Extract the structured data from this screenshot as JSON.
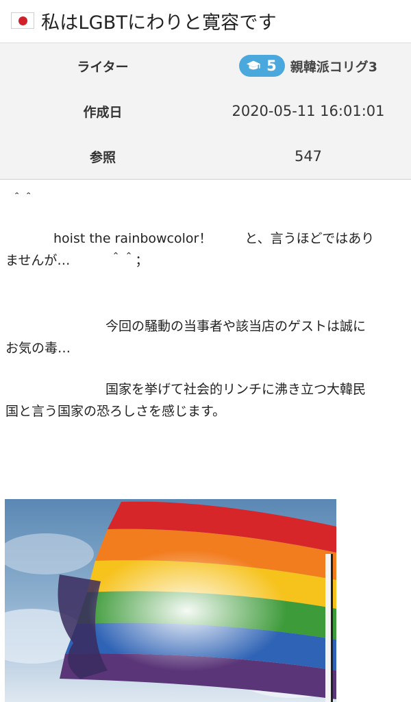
{
  "post": {
    "title": "私はLGBTにわりと寛容です",
    "flag_icon": "japan-flag-icon"
  },
  "meta": {
    "writer_label": "ライター",
    "writer_level": "5",
    "writer_name": "親韓派コリグ3",
    "date_label": "作成日",
    "date_value": "2020-05-11 16:01:01",
    "views_label": "参照",
    "views_value": "547"
  },
  "body": {
    "line_smile": "＾＾",
    "line1_a": "hoist the rainbowcolor！",
    "line1_b": "と、言うほどではあり",
    "line2": "ませんが…　　　＾＾；",
    "line3": "今回の騒動の当事者や該当店のゲストは誠に",
    "line4": "お気の毒…",
    "line5": "国家を挙げて社会的リンチに沸き立つ大韓民",
    "line6": "国と言う国家の恐ろしさを感じます。"
  },
  "colors": {
    "badge": "#4aa8dc",
    "meta_bg": "#f3f3f3",
    "flag_red": "#d0202a"
  }
}
